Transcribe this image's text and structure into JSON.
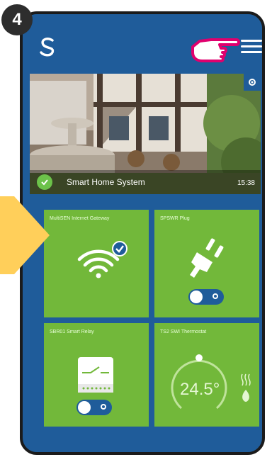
{
  "step_number": "4",
  "hero": {
    "title": "Smart Home System",
    "time": "15:38"
  },
  "tiles": [
    {
      "label": "MultiSEN Internet Gateway",
      "icon": "wifi-icon"
    },
    {
      "label": "SPSWR Plug",
      "icon": "plug-icon"
    },
    {
      "label": "SBR01 Smart Relay",
      "icon": "relay-icon"
    },
    {
      "label": "TS2 SWI Thermostat",
      "icon": "thermostat-icon",
      "temperature": "24.5°"
    }
  ],
  "colors": {
    "app_blue": "#1f5c9a",
    "tile_green": "#72b83a",
    "accent_yellow": "#ffcf5a",
    "hand_pink": "#e0006e"
  }
}
